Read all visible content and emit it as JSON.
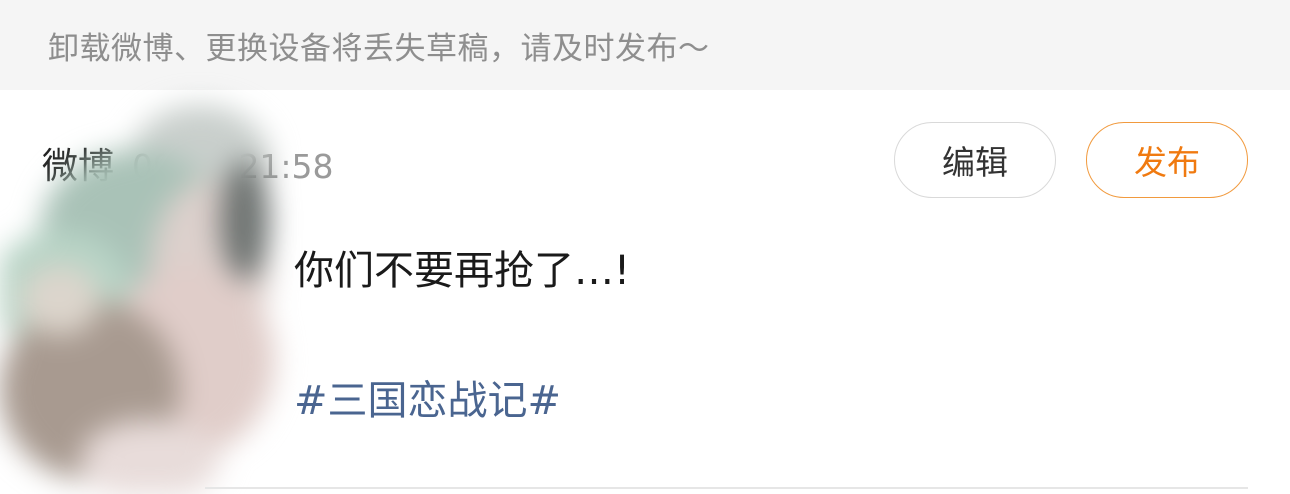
{
  "banner": {
    "notice": "卸载微博、更换设备将丢失草稿，请及时发布～"
  },
  "draft": {
    "source": "微博",
    "timestamp": "09-04 21:58",
    "edit_label": "编辑",
    "publish_label": "发布",
    "content": "你们不要再抢了…!",
    "topic": "#三国恋战记#"
  },
  "colors": {
    "banner_bg": "#f5f5f5",
    "accent_orange": "#f07a10",
    "topic_blue": "#4a6590",
    "muted_gray": "#9a9a9a"
  }
}
